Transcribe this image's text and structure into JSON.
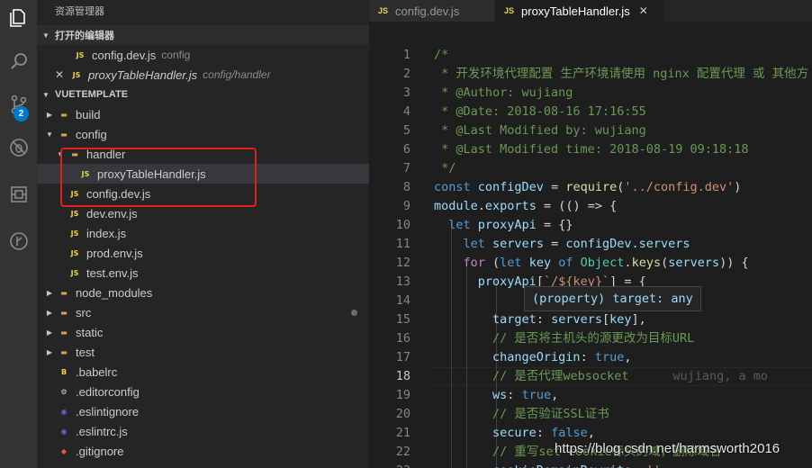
{
  "activity_bar": {
    "icons": [
      "files-icon",
      "search-icon",
      "source-control-icon",
      "debug-icon",
      "extensions-icon",
      "git-lens-icon"
    ],
    "scm_badge": "2"
  },
  "sidebar": {
    "title": "资源管理器",
    "open_editors_label": "打开的编辑器",
    "open_editors": [
      {
        "name": "config.dev.js",
        "desc": "config",
        "modified": false
      },
      {
        "name": "proxyTableHandler.js",
        "desc": "config/handler",
        "modified": true
      }
    ],
    "project_label": "VUETEMPLATE",
    "tree": [
      {
        "label": "build",
        "type": "folder",
        "depth": 1,
        "expanded": false
      },
      {
        "label": "config",
        "type": "folder",
        "depth": 1,
        "expanded": true
      },
      {
        "label": "handler",
        "type": "folder",
        "depth": 2,
        "expanded": true
      },
      {
        "label": "proxyTableHandler.js",
        "type": "js",
        "depth": 3,
        "selected": true
      },
      {
        "label": "config.dev.js",
        "type": "js",
        "depth": 2
      },
      {
        "label": "dev.env.js",
        "type": "js",
        "depth": 2
      },
      {
        "label": "index.js",
        "type": "js",
        "depth": 2
      },
      {
        "label": "prod.env.js",
        "type": "js",
        "depth": 2
      },
      {
        "label": "test.env.js",
        "type": "js",
        "depth": 2
      },
      {
        "label": "node_modules",
        "type": "folder",
        "depth": 1,
        "expanded": false
      },
      {
        "label": "src",
        "type": "folder",
        "depth": 1,
        "expanded": false,
        "modified_dot": true
      },
      {
        "label": "static",
        "type": "folder",
        "depth": 1,
        "expanded": false
      },
      {
        "label": "test",
        "type": "folder",
        "depth": 1,
        "expanded": false
      },
      {
        "label": ".babelrc",
        "type": "babel",
        "depth": 1
      },
      {
        "label": ".editorconfig",
        "type": "gear",
        "depth": 1
      },
      {
        "label": ".eslintignore",
        "type": "eslint",
        "depth": 1
      },
      {
        "label": ".eslintrc.js",
        "type": "eslint",
        "depth": 1
      },
      {
        "label": ".gitignore",
        "type": "git",
        "depth": 1
      }
    ]
  },
  "tabs": [
    {
      "label": "config.dev.js",
      "active": false
    },
    {
      "label": "proxyTableHandler.js",
      "active": true
    }
  ],
  "editor": {
    "current_line": 18,
    "line_numbers": [
      "1",
      "2",
      "3",
      "4",
      "5",
      "6",
      "7",
      "8",
      "9",
      "10",
      "11",
      "12",
      "13",
      "14",
      "15",
      "16",
      "17",
      "18",
      "19",
      "20",
      "21",
      "22",
      "23"
    ],
    "tooltip": "(property) target: any",
    "blame": "wujiang, a mo",
    "lines": [
      "/*",
      " * 开发环境代理配置 生产环境请使用 nginx 配置代理 或 其他方",
      " * @Author: wujiang",
      " * @Date: 2018-08-16 17:16:55",
      " * @Last Modified by: wujiang",
      " * @Last Modified time: 2018-08-19 09:18:18",
      " */",
      "const configDev = require('../config.dev')",
      "module.exports = (() => {",
      "  let proxyApi = {}",
      "    let servers = configDev.servers",
      "    for (let key of Object.keys(servers)) {",
      "      proxyApi[`/${key}`] = {",
      "",
      "        target: servers[key],",
      "        // 是否将主机头的源更改为目标URL",
      "        changeOrigin: true,",
      "        // 是否代理websocket",
      "        ws: true,",
      "        // 是否验证SSL证书",
      "        secure: false,",
      "        // 重写set-cookie标头的域，删除域名",
      "        cookieDomainRewrite: ''"
    ]
  },
  "watermark": "https://blog.csdn.net/harmsworth2016"
}
